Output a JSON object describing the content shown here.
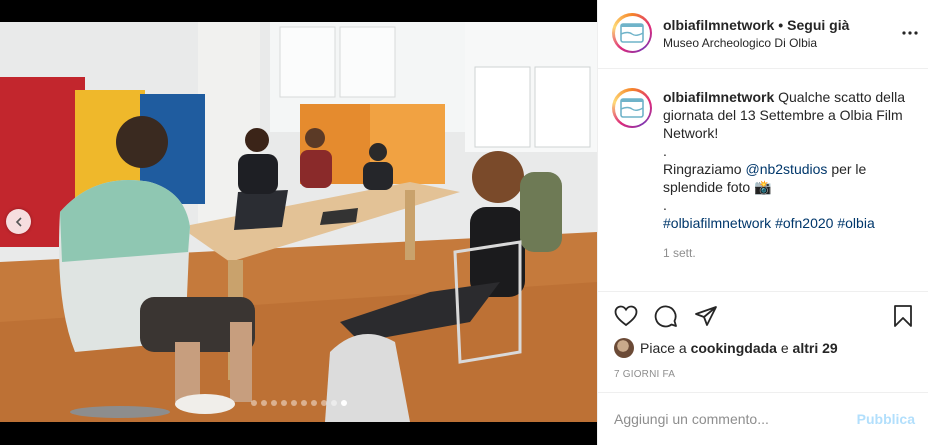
{
  "post": {
    "username": "olbiafilmnetwork",
    "separator": "•",
    "follow_status": "Segui già",
    "location": "Museo Archeologico Di Olbia"
  },
  "caption": {
    "username": "olbiafilmnetwork",
    "line1": "Qualche scatto della giornata del 13 Settembre a Olbia Film Network!",
    "dot1": ".",
    "thanks_prefix": "Ringraziamo",
    "mention": "@nb2studios",
    "thanks_suffix": "per le splendide foto 📸",
    "dot2": ".",
    "hashtags": [
      "#olbiafilmnetwork",
      "#ofn2020",
      "#olbia"
    ],
    "time": "1 sett."
  },
  "likes": {
    "prefix": "Piace a",
    "user": "cookingdada",
    "middle": "e",
    "others": "altri 29"
  },
  "posted_ago": "7 GIORNI FA",
  "comment": {
    "placeholder": "Aggiungi un commento...",
    "publish": "Pubblica"
  },
  "carousel": {
    "count": 10,
    "active_index": 9
  },
  "icons": {
    "like": "heart-icon",
    "comment": "comment-icon",
    "share": "paper-plane-icon",
    "save": "bookmark-icon",
    "more": "more-options-icon",
    "prev": "chevron-left-icon"
  },
  "colors": {
    "link": "#00376b",
    "muted": "#8e8e8e",
    "publish_disabled": "#b2dffc"
  }
}
